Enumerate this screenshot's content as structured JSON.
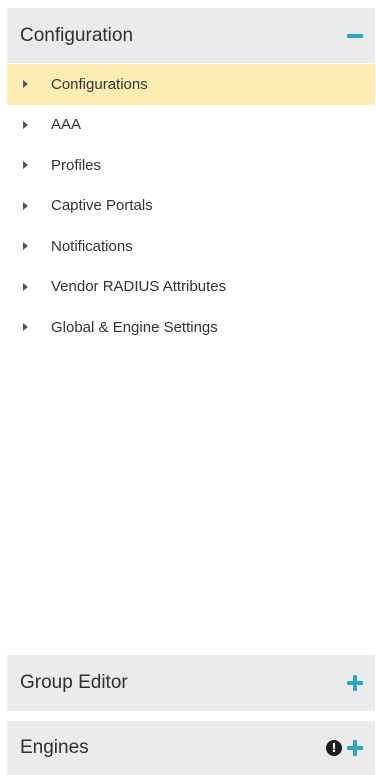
{
  "configuration": {
    "title": "Configuration",
    "toggle_icon": "minus-icon",
    "items": [
      {
        "label": "Configurations",
        "selected": true
      },
      {
        "label": "AAA",
        "selected": false
      },
      {
        "label": "Profiles",
        "selected": false
      },
      {
        "label": "Captive Portals",
        "selected": false
      },
      {
        "label": "Notifications",
        "selected": false
      },
      {
        "label": "Vendor RADIUS Attributes",
        "selected": false
      },
      {
        "label": "Global & Engine Settings",
        "selected": false
      }
    ]
  },
  "group_editor": {
    "title": "Group Editor",
    "toggle_icon": "plus-icon"
  },
  "engines": {
    "title": "Engines",
    "status_icon": "warning-icon",
    "toggle_icon": "plus-icon"
  },
  "colors": {
    "accent": "#2aa6c4",
    "header_bg": "#ebebeb",
    "selected_bg": "#fdedb3"
  }
}
